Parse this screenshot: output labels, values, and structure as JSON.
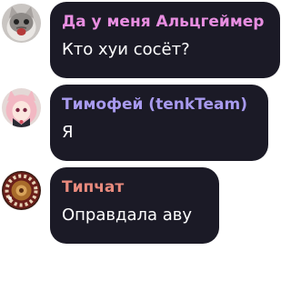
{
  "messages": [
    {
      "author": "Да у меня Альцгеймер",
      "author_color": "#e88ee1",
      "text": "Кто хуи сосёт?",
      "avatar_icon": "cat-avatar-icon"
    },
    {
      "author": "Тимофей (tenkTeam)",
      "author_color": "#a89aee",
      "text": "Я",
      "avatar_icon": "anime-girl-avatar-icon"
    },
    {
      "author": "Типчат",
      "author_color": "#e88a7d",
      "text": "Оправдала аву",
      "avatar_icon": "roulette-avatar-icon"
    }
  ],
  "colors": {
    "bubble_background": "#1b1a26",
    "message_text": "#ffffff",
    "page_background": "#ffffff"
  }
}
